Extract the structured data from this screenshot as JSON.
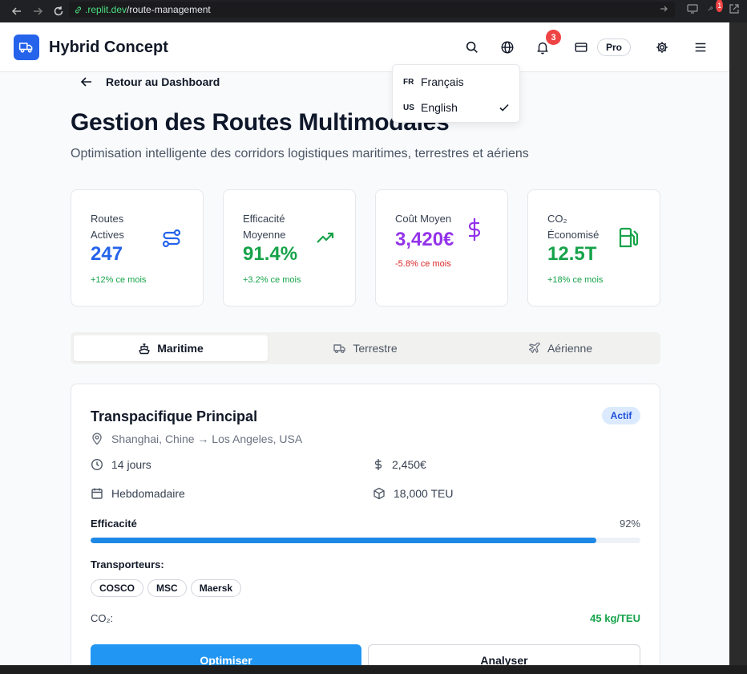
{
  "browser": {
    "url_host": ".replit.dev",
    "url_path": "/route-management",
    "extension_badge": "1"
  },
  "header": {
    "brand": "Hybrid Concept",
    "notification_count": "3",
    "plan_label": "Pro"
  },
  "language_menu": {
    "items": [
      {
        "code": "FR",
        "label": "Français",
        "selected": false
      },
      {
        "code": "US",
        "label": "English",
        "selected": true
      }
    ]
  },
  "back_link": "Retour au Dashboard",
  "page": {
    "title": "Gestion des Routes Multimodales",
    "subtitle": "Optimisation intelligente des corridors logistiques maritimes, terrestres et aériens"
  },
  "stats": [
    {
      "label": "Routes Actives",
      "value": "247",
      "change": "+12% ce mois",
      "value_color": "#2563eb",
      "change_color": "#16a34a",
      "icon": "route-icon"
    },
    {
      "label": "Efficacité Moyenne",
      "value": "91.4%",
      "change": "+3.2% ce mois",
      "value_color": "#16a34a",
      "change_color": "#16a34a",
      "icon": "trending-up-icon"
    },
    {
      "label": "Coût Moyen",
      "value": "3,420€",
      "change": "-5.8% ce mois",
      "value_color": "#9333ea",
      "change_color": "#dc2626",
      "icon": "dollar-icon"
    },
    {
      "label": "CO₂ Économisé",
      "value": "12.5T",
      "change": "+18% ce mois",
      "value_color": "#16a34a",
      "change_color": "#16a34a",
      "icon": "fuel-icon"
    }
  ],
  "tabs": [
    {
      "label": "Maritime",
      "icon": "ship-icon",
      "active": true
    },
    {
      "label": "Terrestre",
      "icon": "truck-icon",
      "active": false
    },
    {
      "label": "Aérienne",
      "icon": "plane-icon",
      "active": false
    }
  ],
  "route": {
    "name": "Transpacifique Principal",
    "status": "Actif",
    "path": "Shanghai, Chine → Los Angeles, USA",
    "duration": "14 jours",
    "cost": "2,450€",
    "frequency": "Hebdomadaire",
    "capacity": "18,000 TEU",
    "efficiency_label": "Efficacité",
    "efficiency_value": "92%",
    "efficiency_fraction": 0.92,
    "carriers_label": "Transporteurs:",
    "carriers": [
      "COSCO",
      "MSC",
      "Maersk"
    ],
    "co2_label": "CO₂:",
    "co2_value": "45 kg/TEU",
    "optimize_label": "Optimiser",
    "analyze_label": "Analyser"
  },
  "colors": {
    "accent": "#2563eb",
    "progress": "#1e88e5",
    "primary_button": "#2196f3"
  }
}
